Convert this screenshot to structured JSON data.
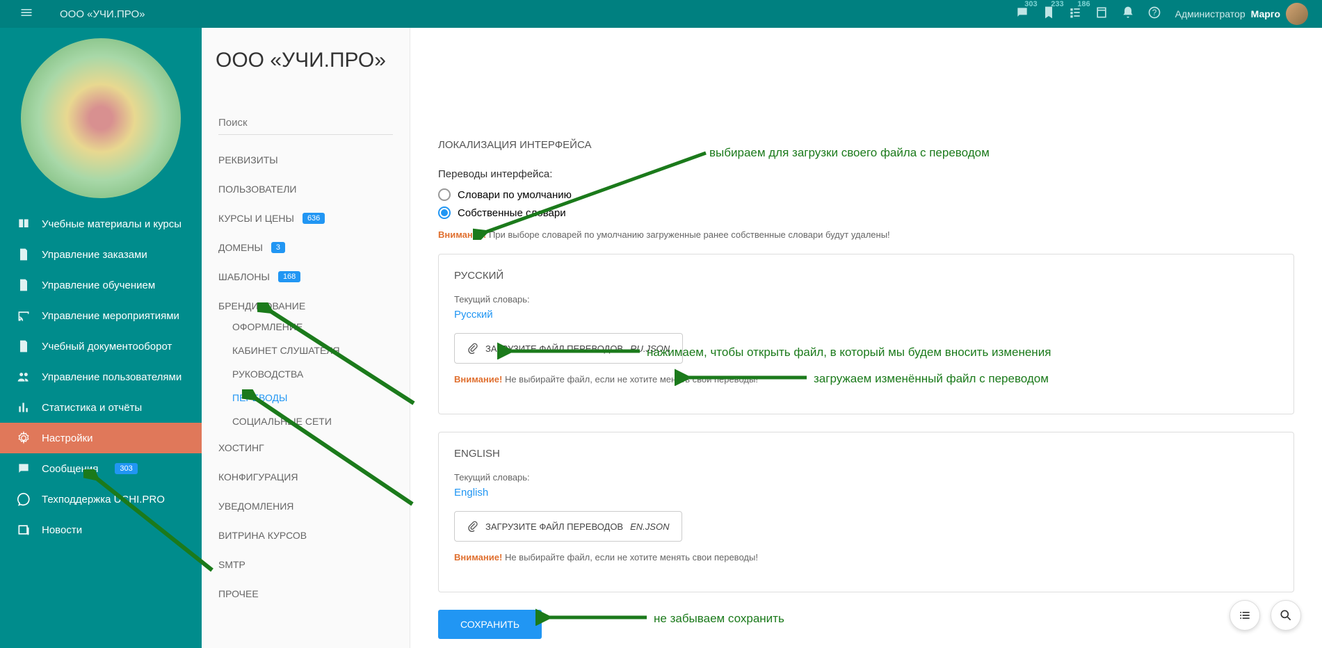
{
  "header": {
    "title": "ООО «УЧИ.ПРО»",
    "badges": {
      "chat": "303",
      "doc": "233",
      "list": "186"
    },
    "user_role": "Администратор",
    "user_name": "Марго"
  },
  "sidebar": {
    "items": [
      {
        "label": "Учебные материалы и курсы",
        "icon": "book"
      },
      {
        "label": "Управление заказами",
        "icon": "file"
      },
      {
        "label": "Управление обучением",
        "icon": "file"
      },
      {
        "label": "Управление мероприятиями",
        "icon": "cast"
      },
      {
        "label": "Учебный документооборот",
        "icon": "doc"
      },
      {
        "label": "Управление пользователями",
        "icon": "people"
      },
      {
        "label": "Статистика и отчёты",
        "icon": "stats"
      },
      {
        "label": "Настройки",
        "icon": "gear",
        "active": true
      },
      {
        "label": "Сообщения",
        "icon": "msg",
        "badge": "303"
      },
      {
        "label": "Техподдержка UCHI.PRO",
        "icon": "support"
      },
      {
        "label": "Новости",
        "icon": "news"
      }
    ]
  },
  "page_title": "ООО «УЧИ.ПРО»",
  "subnav": {
    "search_placeholder": "Поиск",
    "items": [
      {
        "label": "РЕКВИЗИТЫ"
      },
      {
        "label": "ПОЛЬЗОВАТЕЛИ"
      },
      {
        "label": "КУРСЫ И ЦЕНЫ",
        "badge": "636"
      },
      {
        "label": "ДОМЕНЫ",
        "badge": "3"
      },
      {
        "label": "ШАБЛОНЫ",
        "badge": "168"
      },
      {
        "label": "БРЕНДИРОВАНИЕ",
        "expanded": true,
        "children": [
          {
            "label": "ОФОРМЛЕНИЕ"
          },
          {
            "label": "КАБИНЕТ СЛУШАТЕЛЯ"
          },
          {
            "label": "РУКОВОДСТВА"
          },
          {
            "label": "ПЕРЕВОДЫ",
            "active": true
          },
          {
            "label": "СОЦИАЛЬНЫЕ СЕТИ"
          }
        ]
      },
      {
        "label": "ХОСТИНГ"
      },
      {
        "label": "КОНФИГУРАЦИЯ"
      },
      {
        "label": "УВЕДОМЛЕНИЯ"
      },
      {
        "label": "ВИТРИНА КУРСОВ"
      },
      {
        "label": "SMTP"
      },
      {
        "label": "ПРОЧЕЕ"
      }
    ]
  },
  "content": {
    "section_title": "ЛОКАЛИЗАЦИЯ ИНТЕРФЕЙСА",
    "translations_label": "Переводы интерфейса:",
    "radio_default": "Словари по умолчанию",
    "radio_custom": "Собственные словари",
    "warning_prefix": "Внимание!",
    "warning_main": "При выборе словарей по умолчанию загруженные ранее собственные словари будут удалены!",
    "panels": [
      {
        "lang_title": "РУССКИЙ",
        "current_label": "Текущий словарь:",
        "current_link": "Русский",
        "upload_label": "ЗАГРУЗИТЕ ФАЙЛ ПЕРЕВОДОВ",
        "upload_file": "RU.JSON",
        "warn_msg": "Не выбирайте файл, если не хотите менять свои переводы!"
      },
      {
        "lang_title": "ENGLISH",
        "current_label": "Текущий словарь:",
        "current_link": "English",
        "upload_label": "ЗАГРУЗИТЕ ФАЙЛ ПЕРЕВОДОВ",
        "upload_file": "EN.JSON",
        "warn_msg": "Не выбирайте файл, если не хотите менять свои переводы!"
      }
    ],
    "save_button": "СОХРАНИТЬ"
  },
  "annotations": {
    "a1": "выбираем для загрузки своего файла с переводом",
    "a2": "нажимаем, чтобы открыть файл, в который мы будем вносить изменения",
    "a3": "загружаем изменённый файл с переводом",
    "a4": "не забываем сохранить"
  }
}
